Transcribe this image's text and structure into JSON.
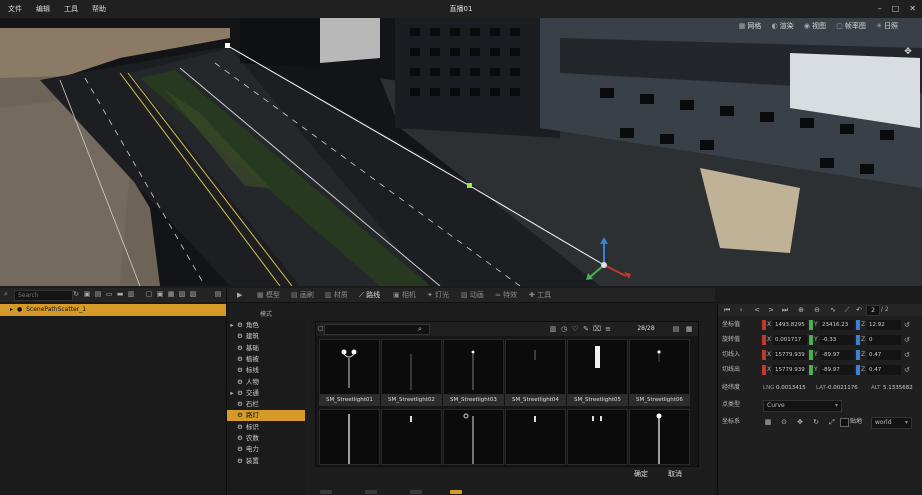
{
  "menu": [
    "文件",
    "编辑",
    "工具",
    "帮助"
  ],
  "window_title": "直播01",
  "window_controls": [
    "–",
    "□",
    "✕"
  ],
  "viewport_toolbar": [
    {
      "icon": "grid-icon",
      "glyph": "▦",
      "label": "网格"
    },
    {
      "icon": "shading-icon",
      "glyph": "◐",
      "label": "渲染"
    },
    {
      "icon": "view-icon",
      "glyph": "◉",
      "label": "视图"
    },
    {
      "icon": "frame-icon",
      "glyph": "▢",
      "label": "帧率图"
    },
    {
      "icon": "sun-icon",
      "glyph": "✳",
      "label": "日照"
    }
  ],
  "viewport_side": [
    {
      "name": "move-icon",
      "glyph": "✥"
    },
    {
      "name": "orbit-icon",
      "glyph": "✇"
    },
    {
      "name": "person-icon",
      "glyph": "⅄"
    },
    {
      "name": "camera-icon",
      "glyph": "⎔"
    }
  ],
  "outliner": {
    "search_placeholder": "Search",
    "row": "ScenePathScatter_1"
  },
  "browser": {
    "tabs": [
      {
        "icon": "▦",
        "label": "模型"
      },
      {
        "icon": "▤",
        "label": "画刷"
      },
      {
        "icon": "▥",
        "label": "材质"
      },
      {
        "icon": "⟋",
        "label": "路线"
      },
      {
        "icon": "▣",
        "label": "相机"
      },
      {
        "icon": "✦",
        "label": "灯光"
      },
      {
        "icon": "▨",
        "label": "动画"
      },
      {
        "icon": "≈",
        "label": "特效"
      },
      {
        "icon": "✚",
        "label": "工具"
      }
    ],
    "active_tab": 3,
    "category_header": "模式",
    "categories": [
      {
        "expand": "▸",
        "label": "角色"
      },
      {
        "expand": "",
        "label": "建筑"
      },
      {
        "expand": "",
        "label": "基础"
      },
      {
        "expand": "",
        "label": "植被"
      },
      {
        "expand": "",
        "label": "标线"
      },
      {
        "expand": "",
        "label": "人物"
      },
      {
        "expand": "▸",
        "label": "交通"
      },
      {
        "expand": "",
        "label": "石栏"
      },
      {
        "expand": "",
        "label": "路灯"
      },
      {
        "expand": "",
        "label": "标识"
      },
      {
        "expand": "",
        "label": "农数"
      },
      {
        "expand": "",
        "label": "电力"
      },
      {
        "expand": "",
        "label": "装置"
      }
    ],
    "active_category": 8,
    "asset_count": "28/28",
    "assets_row1": [
      "SM_Streetlight01",
      "SM_Streetlight02",
      "SM_Streetlight03",
      "SM_Streetlight04",
      "SM_Streetlight05",
      "SM_Streetlight06"
    ],
    "confirm": "确定",
    "cancel": "取消"
  },
  "details": {
    "frame_value": "2",
    "frame_total": "/ 2",
    "rows": [
      {
        "label": "坐标值",
        "x": "1493.8295",
        "y": "23416.23",
        "z": "12.92"
      },
      {
        "label": "旋转值",
        "x": "0.001717",
        "y": "-0.33",
        "z": "0"
      },
      {
        "label": "切线入",
        "x": "15779.939",
        "y": "-89.97",
        "z": "0.47"
      },
      {
        "label": "切线出",
        "x": "15779.939",
        "y": "-89.97",
        "z": "0.47"
      }
    ],
    "geo_label": "经纬度",
    "geo": {
      "lng_label": "LNG",
      "lng": "0.0013415",
      "lat_label": "LAT",
      "lat": "-0.0021176",
      "alt_label": "ALT",
      "alt": "5.1335682"
    },
    "point_type_label": "点类型",
    "point_type": "Curve",
    "coord_label": "坐标系",
    "snap_label": "贴地",
    "coord_space": "world"
  },
  "colors": {
    "accent": "#d69a28",
    "x_axis": "#c0392b",
    "y_axis": "#4caf50",
    "z_axis": "#3d7fd6"
  }
}
